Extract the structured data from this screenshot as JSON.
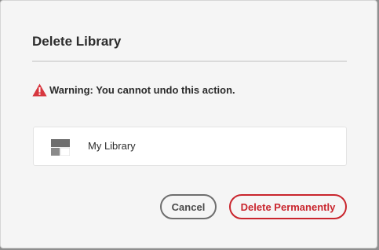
{
  "dialog": {
    "title": "Delete Library",
    "warning": {
      "icon": "warning-triangle-icon",
      "text": "Warning: You cannot undo this action.",
      "color": "#d7373f"
    },
    "library": {
      "icon": "library-thumbnail-icon",
      "name": "My Library"
    },
    "buttons": {
      "cancel_label": "Cancel",
      "delete_label": "Delete Permanently"
    },
    "colors": {
      "destructive": "#c9252d",
      "secondary": "#6e6e6e"
    }
  }
}
